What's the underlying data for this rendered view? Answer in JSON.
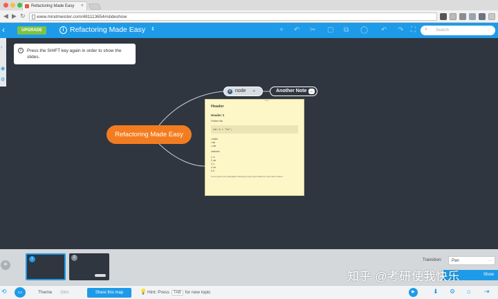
{
  "browser": {
    "tab_title": "Refactoring Made Easy",
    "tab_close": "×",
    "url": "www.mindmeister.com/481113654#slideshow",
    "back_glyph": "◀",
    "forward_glyph": "▶",
    "reload_glyph": "↻"
  },
  "toolbar": {
    "back_glyph": "‹",
    "upgrade_label": "UPGRADE",
    "info_glyph": "i",
    "map_title": "Refactoring Made Easy",
    "title_dropdown_glyph": "⇕",
    "search_placeholder": "Search",
    "search_glyph": "⌕",
    "tool_glyphs": [
      "+",
      "↶",
      "✂",
      "▢",
      "⧉",
      "◯",
      "↶",
      "↷",
      "⛶"
    ]
  },
  "left_panel": {
    "glyphs": [
      "›",
      "◉",
      "⚙"
    ]
  },
  "hint": {
    "info_glyph": "i",
    "text": "Press the SHIFT key again in order to show the slides."
  },
  "mindmap": {
    "root_label": "Refactoring Made Easy",
    "node_label": "node",
    "node_note_glyph": "≡",
    "node_chevron": "»",
    "another_note_label": "Another Note",
    "another_note_badge": "…",
    "note": {
      "heading1": "Header",
      "heading3": "Header 3",
      "text1": "Further list:",
      "code": "var  a = \"hi\";",
      "list1": [
        "• bullet",
        "• list",
        "• one"
      ],
      "text2": "ordered:",
      "list2": [
        "1.  a",
        "2.  ab",
        "3.  c",
        "4.  be",
        "5.  h"
      ],
      "paragraph": "Lorem ipsum text paragraph showing a long note inside the map node content."
    }
  },
  "slides": {
    "add_glyph": "+",
    "thumbs": [
      {
        "number": "1",
        "active": true
      },
      {
        "number": "2",
        "active": false
      }
    ],
    "transition_label": "Transition:",
    "transition_value": "Pan",
    "transition_dots": "...",
    "present_label": "Show"
  },
  "bottom_bar": {
    "history_glyph": "⟲",
    "monitor_glyph": "▭",
    "theme_label": "Theme",
    "theme_value": "Slim",
    "share_label": "Share this map",
    "hint_bulb": "💡",
    "hint_prefix": "Hint: Press",
    "hint_key": "TAB",
    "hint_suffix": "for new topic",
    "right_glyphs": [
      "▶",
      "⬇",
      "⚙",
      "⌂",
      "⇥"
    ]
  },
  "watermark": "知乎 @考研使我快乐",
  "colors": {
    "accent": "#1d9be8",
    "upgrade": "#7dc242",
    "root_node": "#f47c20",
    "canvas": "#2f3640",
    "note_bg": "#fdf6c7"
  }
}
